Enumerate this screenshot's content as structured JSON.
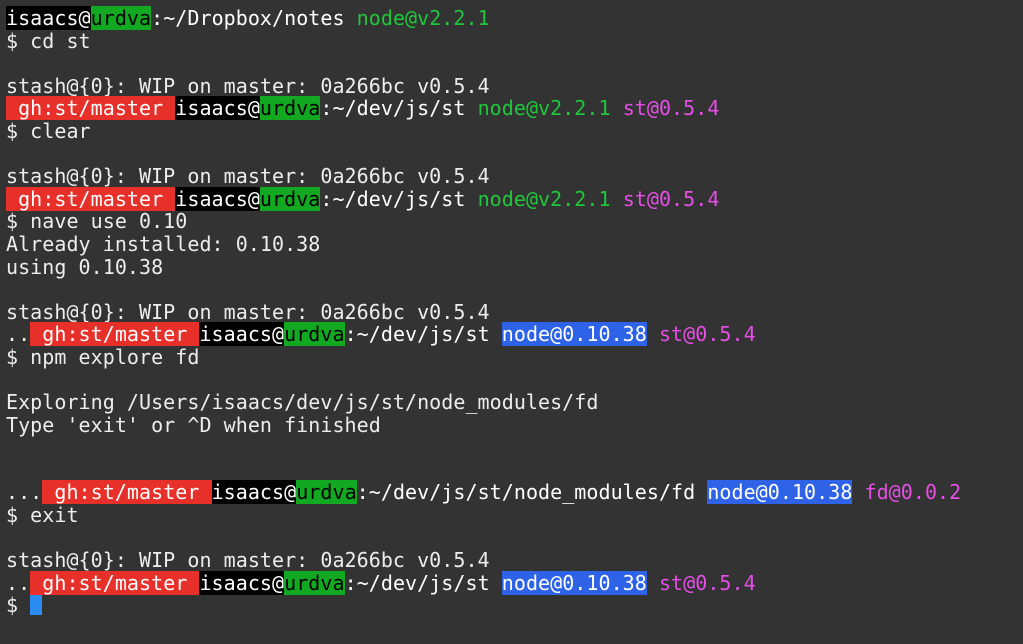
{
  "colors": {
    "background": "#333333",
    "user_bg": "#000000",
    "host_bg": "#13a821",
    "git_bg": "#e8302a",
    "node_fg": "#1ec83a",
    "node_highlight_bg": "#2e63e8",
    "package_fg": "#e64ee6",
    "cursor": "#2a8cf0"
  },
  "lines": [
    {
      "segments": [
        {
          "t": "user",
          "text": "isaacs@"
        },
        {
          "t": "host",
          "text": "urdva"
        },
        {
          "t": "path",
          "text": ":~/Dropbox/notes "
        },
        {
          "t": "node",
          "text": "node@v2.2.1"
        }
      ]
    },
    {
      "segments": [
        {
          "t": "plain",
          "text": "$ cd st"
        }
      ]
    },
    {
      "segments": []
    },
    {
      "segments": [
        {
          "t": "plain",
          "text": "stash@{0}: WIP on master: 0a266bc v0.5.4"
        }
      ]
    },
    {
      "segments": [
        {
          "t": "git",
          "text": " gh:st/master "
        },
        {
          "t": "user",
          "text": "isaacs@"
        },
        {
          "t": "host",
          "text": "urdva"
        },
        {
          "t": "path",
          "text": ":~/dev/js/st "
        },
        {
          "t": "node",
          "text": "node@v2.2.1"
        },
        {
          "t": "plain",
          "text": " "
        },
        {
          "t": "pkg",
          "text": "st@0.5.4"
        }
      ]
    },
    {
      "segments": [
        {
          "t": "plain",
          "text": "$ clear"
        }
      ]
    },
    {
      "segments": []
    },
    {
      "segments": [
        {
          "t": "plain",
          "text": "stash@{0}: WIP on master: 0a266bc v0.5.4"
        }
      ]
    },
    {
      "segments": [
        {
          "t": "git",
          "text": " gh:st/master "
        },
        {
          "t": "user",
          "text": "isaacs@"
        },
        {
          "t": "host",
          "text": "urdva"
        },
        {
          "t": "path",
          "text": ":~/dev/js/st "
        },
        {
          "t": "node",
          "text": "node@v2.2.1"
        },
        {
          "t": "plain",
          "text": " "
        },
        {
          "t": "pkg",
          "text": "st@0.5.4"
        }
      ]
    },
    {
      "segments": [
        {
          "t": "plain",
          "text": "$ nave use 0.10"
        }
      ]
    },
    {
      "segments": [
        {
          "t": "plain",
          "text": "Already installed: 0.10.38"
        }
      ]
    },
    {
      "segments": [
        {
          "t": "plain",
          "text": "using 0.10.38"
        }
      ]
    },
    {
      "segments": []
    },
    {
      "segments": [
        {
          "t": "plain",
          "text": "stash@{0}: WIP on master: 0a266bc v0.5.4"
        }
      ]
    },
    {
      "segments": [
        {
          "t": "plain",
          "text": ".."
        },
        {
          "t": "git",
          "text": " gh:st/master "
        },
        {
          "t": "user",
          "text": "isaacs@"
        },
        {
          "t": "host",
          "text": "urdva"
        },
        {
          "t": "path",
          "text": ":~/dev/js/st "
        },
        {
          "t": "nodehl",
          "text": "node@0.10.38"
        },
        {
          "t": "plain",
          "text": " "
        },
        {
          "t": "pkg",
          "text": "st@0.5.4"
        }
      ]
    },
    {
      "segments": [
        {
          "t": "plain",
          "text": "$ npm explore fd"
        }
      ]
    },
    {
      "segments": []
    },
    {
      "segments": [
        {
          "t": "plain",
          "text": "Exploring /Users/isaacs/dev/js/st/node_modules/fd"
        }
      ]
    },
    {
      "segments": [
        {
          "t": "plain",
          "text": "Type 'exit' or ^D when finished"
        }
      ]
    },
    {
      "segments": []
    },
    {
      "segments": []
    },
    {
      "segments": [
        {
          "t": "plain",
          "text": "..."
        },
        {
          "t": "git",
          "text": " gh:st/master "
        },
        {
          "t": "user",
          "text": "isaacs@"
        },
        {
          "t": "host",
          "text": "urdva"
        },
        {
          "t": "path",
          "text": ":~/dev/js/st/node_modules/fd "
        },
        {
          "t": "nodehl",
          "text": "node@0.10.38"
        },
        {
          "t": "plain",
          "text": " "
        },
        {
          "t": "pkg",
          "text": "fd@0.0.2"
        }
      ]
    },
    {
      "segments": [
        {
          "t": "plain",
          "text": "$ exit"
        }
      ]
    },
    {
      "segments": []
    },
    {
      "segments": [
        {
          "t": "plain",
          "text": "stash@{0}: WIP on master: 0a266bc v0.5.4"
        }
      ]
    },
    {
      "segments": [
        {
          "t": "plain",
          "text": ".."
        },
        {
          "t": "git",
          "text": " gh:st/master "
        },
        {
          "t": "user",
          "text": "isaacs@"
        },
        {
          "t": "host",
          "text": "urdva"
        },
        {
          "t": "path",
          "text": ":~/dev/js/st "
        },
        {
          "t": "nodehl",
          "text": "node@0.10.38"
        },
        {
          "t": "plain",
          "text": " "
        },
        {
          "t": "pkg",
          "text": "st@0.5.4"
        }
      ]
    },
    {
      "segments": [
        {
          "t": "plain",
          "text": "$ "
        }
      ],
      "cursor": true
    }
  ]
}
